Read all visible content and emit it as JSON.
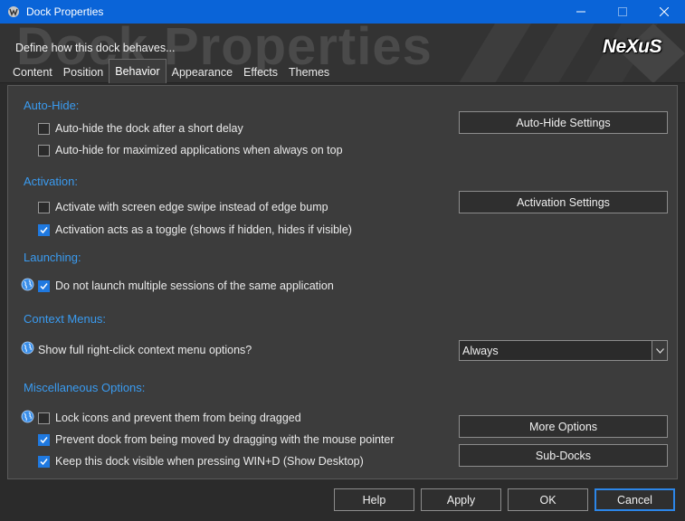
{
  "window": {
    "title": "Dock Properties"
  },
  "header": {
    "background_text": "Dock Properties",
    "description": "Define how this dock behaves...",
    "logo": "NeXuS"
  },
  "tabs": [
    {
      "label": "Content",
      "active": false
    },
    {
      "label": "Position",
      "active": false
    },
    {
      "label": "Behavior",
      "active": true
    },
    {
      "label": "Appearance",
      "active": false
    },
    {
      "label": "Effects",
      "active": false
    },
    {
      "label": "Themes",
      "active": false
    }
  ],
  "autohide": {
    "title": "Auto-Hide:",
    "opt1": {
      "label": "Auto-hide the dock after a short delay",
      "checked": false
    },
    "opt2": {
      "label": "Auto-hide for maximized applications when always on top",
      "checked": false
    },
    "settings_button": "Auto-Hide Settings"
  },
  "activation": {
    "title": "Activation:",
    "opt1": {
      "label": "Activate with screen edge swipe instead of edge bump",
      "checked": false
    },
    "opt2": {
      "label": "Activation acts as a toggle (shows if hidden, hides if visible)",
      "checked": true
    },
    "settings_button": "Activation Settings"
  },
  "launching": {
    "title": "Launching:",
    "opt1": {
      "label": "Do not launch multiple sessions of the same application",
      "checked": true
    }
  },
  "context_menus": {
    "title": "Context Menus:",
    "label": "Show full right-click context menu options?",
    "select_value": "Always"
  },
  "misc": {
    "title": "Miscellaneous Options:",
    "opt1": {
      "label": "Lock icons and prevent them from being dragged",
      "checked": false
    },
    "opt2": {
      "label": "Prevent dock from being moved by dragging with the mouse pointer",
      "checked": true
    },
    "opt3": {
      "label": "Keep this dock visible when pressing WIN+D (Show Desktop)",
      "checked": true
    },
    "more_options_button": "More Options",
    "subdocks_button": "Sub-Docks"
  },
  "footer": {
    "help": "Help",
    "apply": "Apply",
    "ok": "OK",
    "cancel": "Cancel"
  },
  "colors": {
    "titlebar": "#0a64d8",
    "section_title": "#3a9bf0",
    "checkbox_checked": "#1f79e0"
  }
}
